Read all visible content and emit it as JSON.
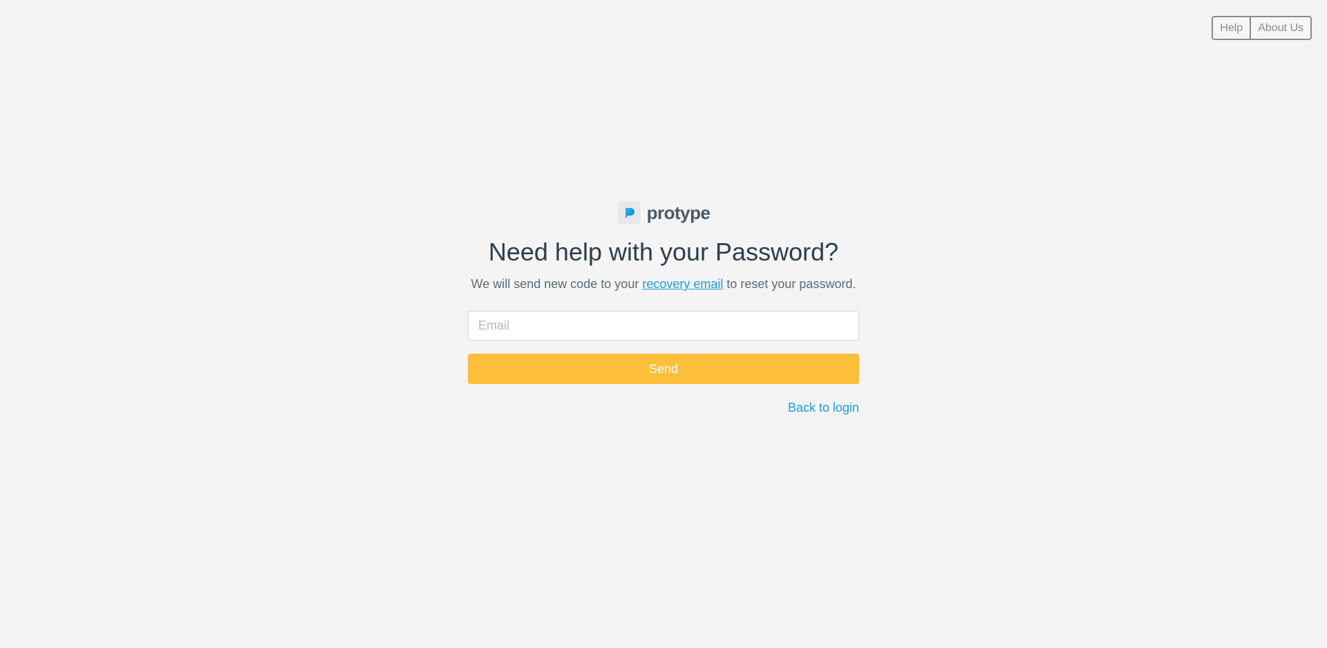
{
  "topnav": {
    "help_label": "Help",
    "about_label": "About Us"
  },
  "brand": {
    "name": "protype",
    "icon": "protype-logo-icon",
    "accent": "#1a9ed6"
  },
  "form": {
    "title": "Need help with your Password?",
    "subtitle_before": "We will send new code to your ",
    "subtitle_link": "recovery email",
    "subtitle_after": " to reset your password.",
    "email_placeholder": "Email",
    "email_value": "",
    "send_label": "Send",
    "back_label": "Back to login"
  },
  "colors": {
    "background": "#f4f4f4",
    "send_button": "#fdbe3a",
    "link": "#1a9ed6",
    "heading": "#2d3e4a"
  }
}
